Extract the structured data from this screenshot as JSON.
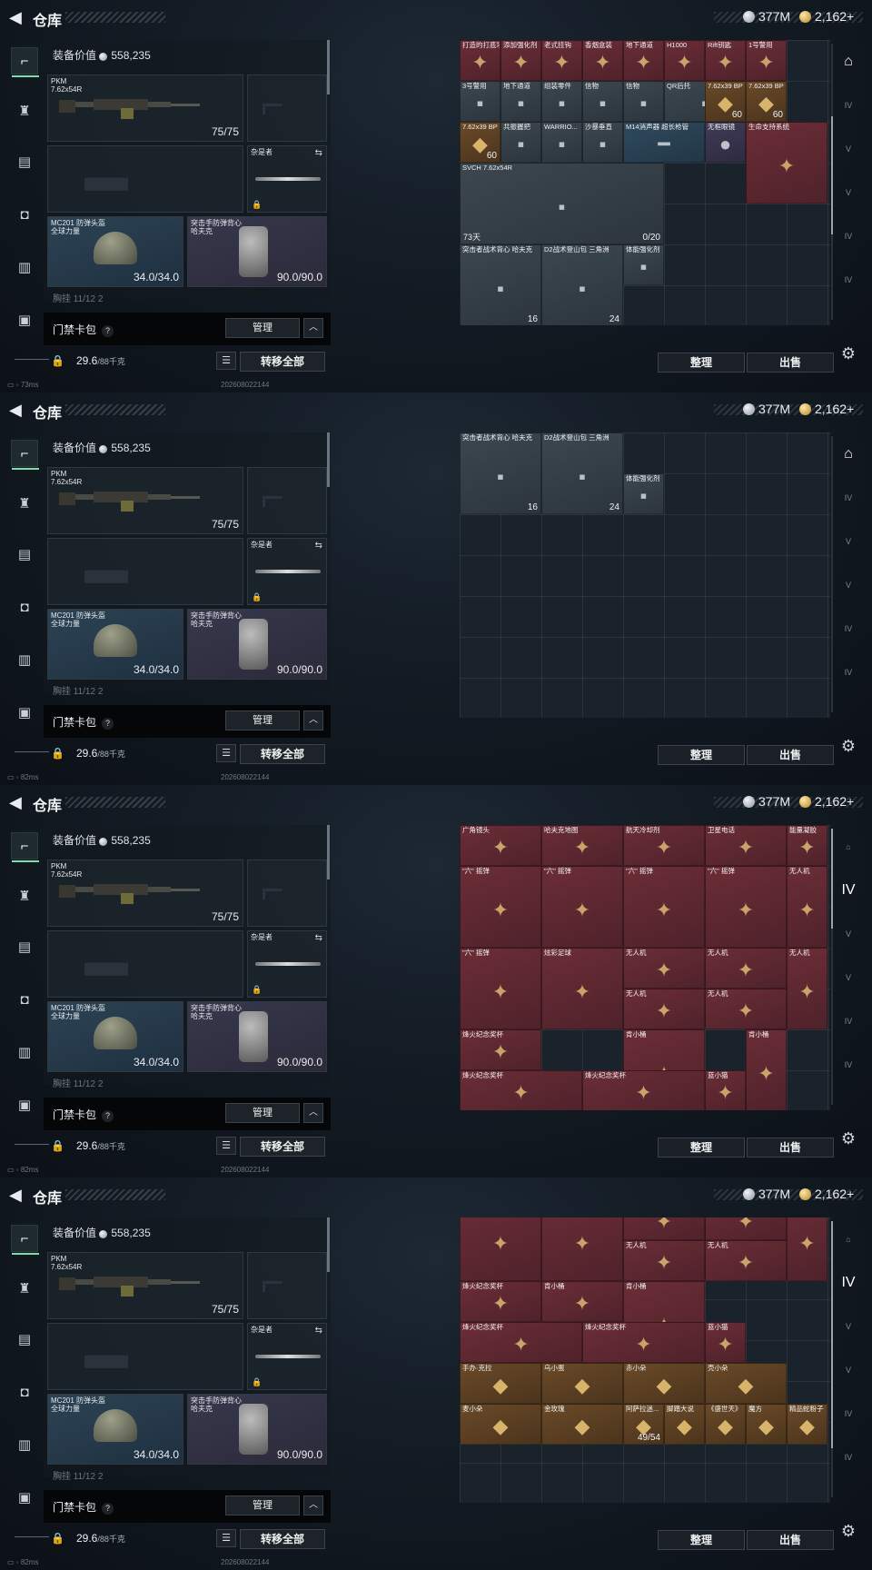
{
  "header": {
    "title": "仓库",
    "silver": "377M",
    "gold": "2,162",
    "gold_plus": "+"
  },
  "sidebar": {
    "icons": [
      "pistol-icon",
      "armor-icon",
      "rig-icon",
      "bag-icon",
      "case-icon",
      "briefcase-icon"
    ]
  },
  "loadout": {
    "equip_value_label": "装备价值",
    "equip_value": "558,235",
    "primary": {
      "name": "PKM",
      "ammo": "7.62x54R",
      "count": "75/75"
    },
    "melee": {
      "name": "杂是者"
    },
    "helmet": {
      "name": "MC201 防弹头盔",
      "sub": "全球力量",
      "durability": "34.0/34.0"
    },
    "armor": {
      "name": "突击手防弹背心",
      "sub": "哈夫克",
      "durability": "90.0/90.0"
    },
    "cutoff_text": "胸挂 11/12 2"
  },
  "key_bag": {
    "label": "门禁卡包",
    "help": "?",
    "manage": "管理",
    "collapse": "︿"
  },
  "weight": {
    "value": "29.6",
    "max": "/88千克"
  },
  "actions": {
    "transfer_all": "转移全部",
    "sort": "整理",
    "sell": "出售"
  },
  "status": {
    "ping1": "73ms",
    "ping2": "82ms",
    "ping3": "82ms",
    "ping4": "82ms",
    "build": "202608022144"
  },
  "stash_views": [
    {
      "items": [
        {
          "name": "打造的打底坯",
          "cls": "r"
        },
        {
          "name": "添加强化剂",
          "cls": "r"
        },
        {
          "name": "老式挂钩",
          "cls": "r"
        },
        {
          "name": "香烟盒装",
          "cls": "r"
        },
        {
          "name": "地下通道",
          "cls": "r"
        },
        {
          "name": "H1000",
          "cls": "r"
        },
        {
          "name": "Rift钥匙",
          "cls": "r"
        },
        {
          "name": "1号警用",
          "cls": "r"
        },
        {
          "name": "3号警用",
          "cls": "g"
        },
        {
          "name": "地下通道",
          "cls": "g"
        },
        {
          "name": "组装零件",
          "cls": "g"
        },
        {
          "name": "信物",
          "cls": "g"
        },
        {
          "name": "信物",
          "cls": "g"
        },
        {
          "name": "QR后托",
          "cls": "g"
        },
        {
          "name": "7.62x39 BP",
          "cls": "o",
          "count": "60"
        },
        {
          "name": "7.62x39 BP",
          "cls": "o",
          "count": "60"
        },
        {
          "name": "7.62x39 BP",
          "cls": "o",
          "count": "60"
        },
        {
          "name": "共振握把",
          "cls": "g"
        },
        {
          "name": "WARRIO...",
          "cls": "g"
        },
        {
          "name": "沙暴垂直",
          "cls": "g"
        },
        {
          "name": "M14消声器 超长枪管",
          "cls": "b"
        },
        {
          "name": "无框眼镜",
          "cls": "p"
        },
        {
          "name": "生命支持系统",
          "cls": "r"
        },
        {
          "name": "SVCH 7.62x54R",
          "cls": "g",
          "count": "0/20",
          "expire": "73天"
        },
        {
          "name": "突击者战术背心 哈夫克",
          "cls": "g",
          "count": "16"
        },
        {
          "name": "D2战术登山包 三角洲",
          "cls": "g",
          "count": "24"
        },
        {
          "name": "体能强化剂",
          "cls": "g"
        }
      ]
    },
    {
      "items": [
        {
          "name": "突击者战术背心 哈夫克",
          "cls": "g",
          "count": "16"
        },
        {
          "name": "D2战术登山包 三角洲",
          "cls": "g",
          "count": "24"
        },
        {
          "name": "体能强化剂",
          "cls": "g"
        }
      ]
    },
    {
      "items": [
        {
          "name": "广角镜头",
          "cls": "r"
        },
        {
          "name": "哈夫克地图",
          "cls": "r"
        },
        {
          "name": "航天冷却剂",
          "cls": "r"
        },
        {
          "name": "卫星电话",
          "cls": "r"
        },
        {
          "name": "能量凝胶",
          "cls": "r"
        },
        {
          "name": "\"六\" 摇弹",
          "cls": "r"
        },
        {
          "name": "\"六\" 摇弹",
          "cls": "r"
        },
        {
          "name": "\"六\" 摇弹",
          "cls": "r"
        },
        {
          "name": "\"六\" 摇弹",
          "cls": "r"
        },
        {
          "name": "无人机",
          "cls": "r"
        },
        {
          "name": "\"六\" 摇弹",
          "cls": "r"
        },
        {
          "name": "炫彩足球",
          "cls": "r"
        },
        {
          "name": "无人机",
          "cls": "r"
        },
        {
          "name": "无人机",
          "cls": "r"
        },
        {
          "name": "无人机",
          "cls": "r"
        },
        {
          "name": "无人机",
          "cls": "r"
        },
        {
          "name": "无人机",
          "cls": "r"
        },
        {
          "name": "烽火纪念奖杯",
          "cls": "r"
        },
        {
          "name": "肯小桶",
          "cls": "r"
        },
        {
          "name": "肯小桶",
          "cls": "r"
        },
        {
          "name": "烽火纪念奖杯",
          "cls": "r"
        },
        {
          "name": "烽火纪念奖杯",
          "cls": "r"
        },
        {
          "name": "蓝小猫",
          "cls": "r"
        },
        {
          "name": "手办·克拉",
          "cls": "o"
        },
        {
          "name": "乌小蛋",
          "cls": "o"
        },
        {
          "name": "赤小朵",
          "cls": "o"
        },
        {
          "name": "壳小朵",
          "cls": "o"
        }
      ]
    },
    {
      "items": [
        {
          "name": "\"六\" 摇弹",
          "cls": "r"
        },
        {
          "name": "炫彩足球",
          "cls": "r"
        },
        {
          "name": "无人机",
          "cls": "r"
        },
        {
          "name": "无人机",
          "cls": "r"
        },
        {
          "name": "无人机",
          "cls": "r"
        },
        {
          "name": "无人机",
          "cls": "r"
        },
        {
          "name": "无人机",
          "cls": "r"
        },
        {
          "name": "烽火纪念奖杯",
          "cls": "r"
        },
        {
          "name": "肯小桶",
          "cls": "r"
        },
        {
          "name": "肯小桶",
          "cls": "r"
        },
        {
          "name": "烽火纪念奖杯",
          "cls": "r"
        },
        {
          "name": "烽火纪念奖杯",
          "cls": "r"
        },
        {
          "name": "蓝小猫",
          "cls": "r"
        },
        {
          "name": "手办·克拉",
          "cls": "o"
        },
        {
          "name": "乌小蛋",
          "cls": "o"
        },
        {
          "name": "赤小朵",
          "cls": "o"
        },
        {
          "name": "壳小朵",
          "cls": "o"
        },
        {
          "name": "麦小朵",
          "cls": "o"
        },
        {
          "name": "金玫瑰",
          "cls": "o"
        },
        {
          "name": "阿萨拉迷...",
          "cls": "o",
          "count": "49/54"
        },
        {
          "name": "脚踏大说",
          "cls": "o"
        },
        {
          "name": "《盛世天》",
          "cls": "o"
        },
        {
          "name": "魔方",
          "cls": "o"
        },
        {
          "name": "精品蛇粉子",
          "cls": "o"
        }
      ]
    }
  ]
}
